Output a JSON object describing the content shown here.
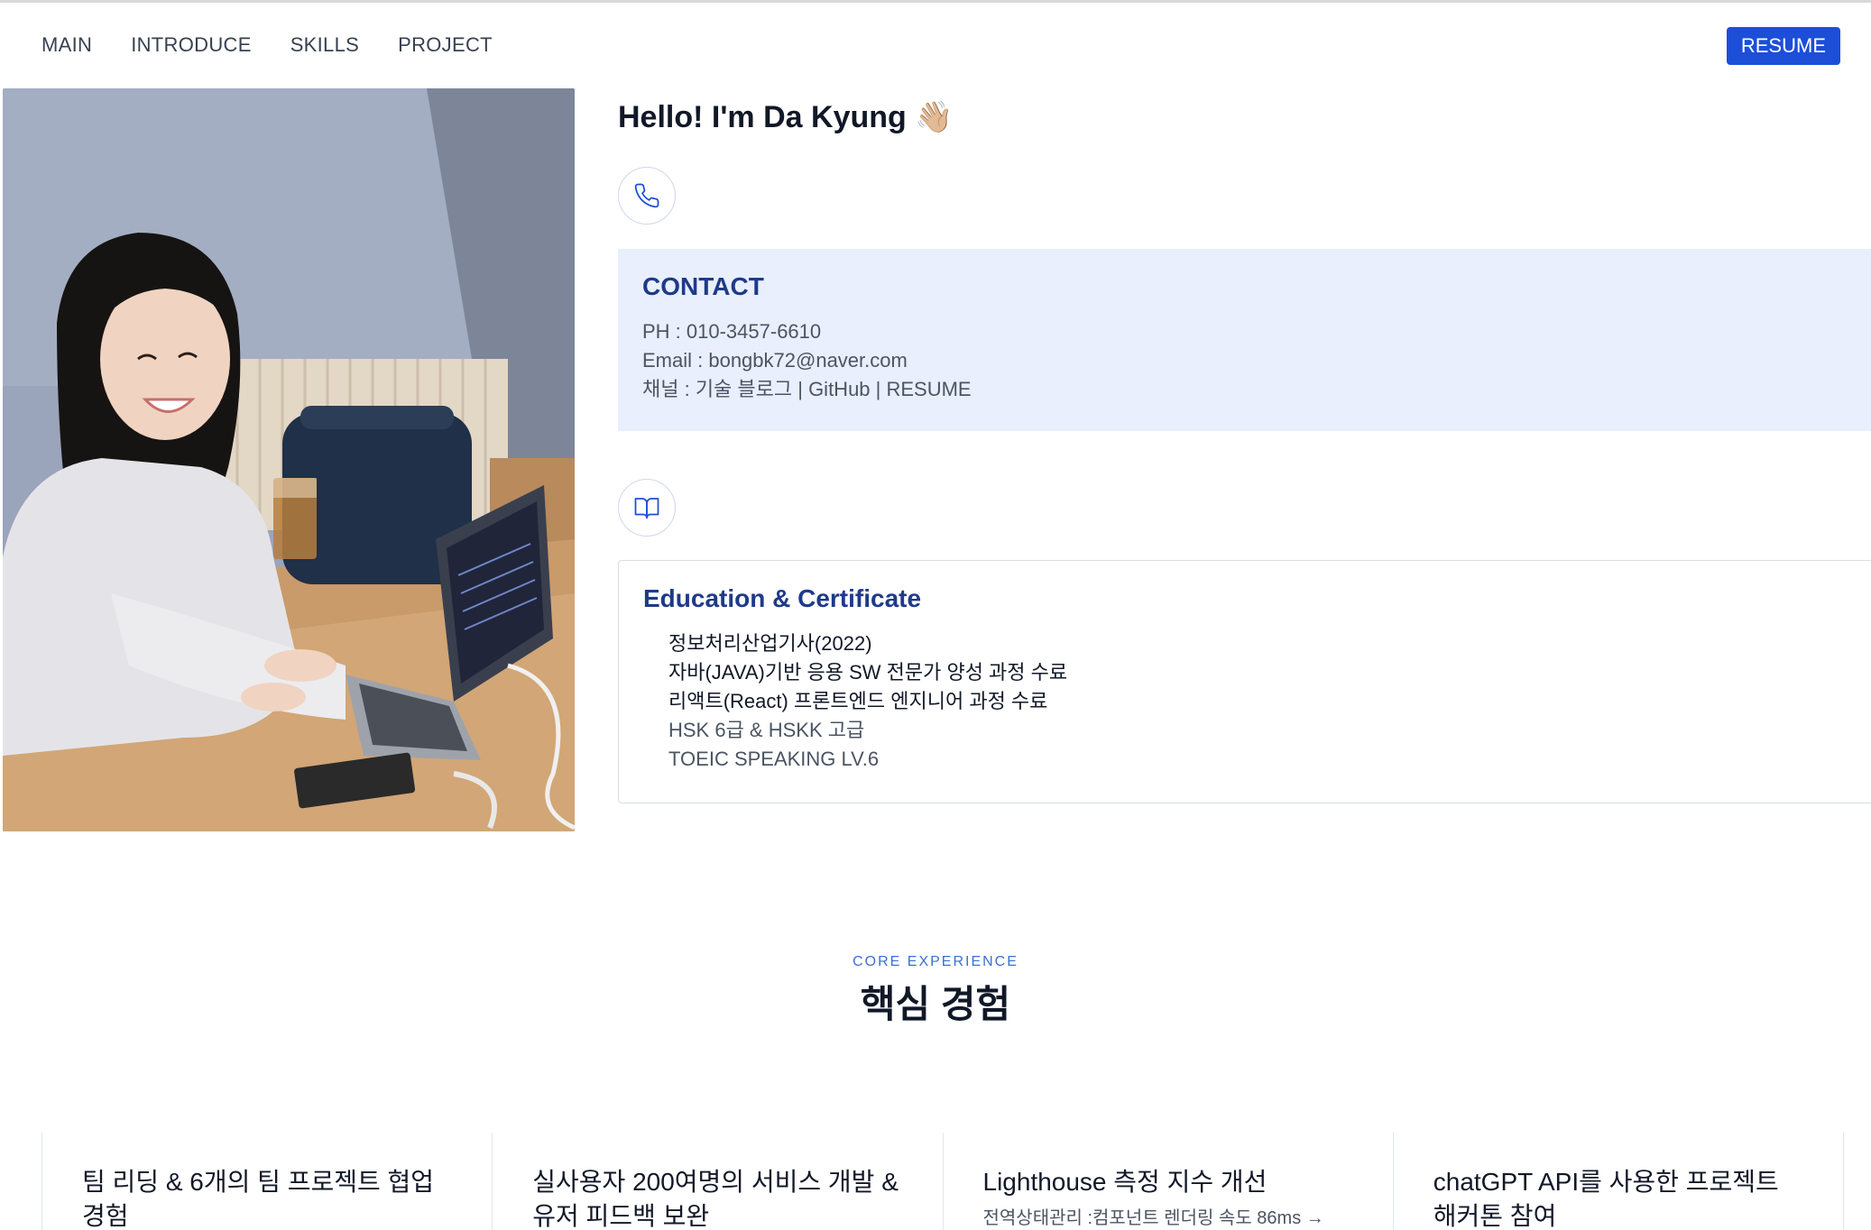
{
  "nav": {
    "links": [
      "MAIN",
      "INTRODUCE",
      "SKILLS",
      "PROJECT"
    ],
    "resume_label": "RESUME"
  },
  "profile": {
    "greeting": "Hello! I'm Da Kyung 👋🏼"
  },
  "contact": {
    "icon": "phone-icon",
    "title": "CONTACT",
    "phone": "PH : 010-3457-6610",
    "email": "Email : bongbk72@naver.com",
    "channel": "채널 : 기술 블로그 | GitHub | RESUME"
  },
  "education": {
    "icon": "book-icon",
    "title": "Education & Certificate",
    "items": [
      "정보처리산업기사(2022)",
      "자바(JAVA)기반 응용 SW 전문가 양성 과정 수료",
      "리액트(React) 프론트엔드 엔지니어 과정 수료",
      "HSK 6급 & HSKK 고급",
      "TOEIC SPEAKING LV.6"
    ]
  },
  "core": {
    "eyebrow": "CORE EXPERIENCE",
    "heading": "핵심 경험",
    "cards": [
      {
        "title": "팀 리딩 & 6개의 팀 프로젝트 협업 경험",
        "sub": ""
      },
      {
        "title": "실사용자 200여명의 서비스 개발 & 유저 피드백 보완",
        "sub": ""
      },
      {
        "title": "Lighthouse 측정 지수 개선",
        "sub": "전역상태관리 :컴포넌트 렌더링 속도 86ms →"
      },
      {
        "title": "chatGPT API를 사용한 프로젝트 해커톤 참여",
        "sub": ""
      }
    ]
  }
}
